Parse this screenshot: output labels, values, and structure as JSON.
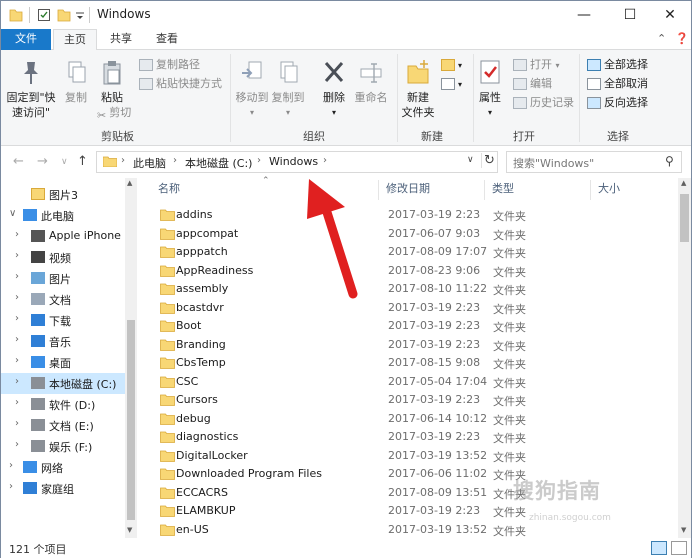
{
  "window": {
    "title": "Windows"
  },
  "controls": {
    "minimize": "—",
    "maximize": "☐",
    "close": "✕"
  },
  "tabs": {
    "file": "文件",
    "home": "主页",
    "share": "共享",
    "view": "查看"
  },
  "ribbon": {
    "clipboard": {
      "label": "剪贴板",
      "pin": "固定到\"快速访问\"",
      "copy": "复制",
      "paste": "粘贴",
      "copy_path": "复制路径",
      "paste_shortcut": "粘贴快捷方式",
      "cut": "剪切"
    },
    "organize": {
      "label": "组织",
      "move_to": "移动到",
      "copy_to": "复制到",
      "delete": "删除",
      "rename": "重命名"
    },
    "new": {
      "label": "新建",
      "new_folder": "新建\n文件夹"
    },
    "open": {
      "label": "打开",
      "properties": "属性",
      "open": "打开",
      "edit": "编辑",
      "history": "历史记录"
    },
    "select": {
      "label": "选择",
      "select_all": "全部选择",
      "select_none": "全部取消",
      "invert": "反向选择"
    }
  },
  "address": {
    "crumbs": [
      "此电脑",
      "本地磁盘 (C:)",
      "Windows"
    ],
    "search_placeholder": "搜索\"Windows\""
  },
  "nav": [
    {
      "label": "图片3",
      "icon": "folder-icon",
      "indent": 0,
      "chevron": ""
    },
    {
      "label": "此电脑",
      "icon": "computer-icon",
      "indent": 0,
      "chevron": "expanded"
    },
    {
      "label": "Apple iPhone",
      "icon": "phone-icon",
      "indent": 1,
      "chevron": "collapsed"
    },
    {
      "label": "视频",
      "icon": "video-icon",
      "indent": 1,
      "chevron": "collapsed"
    },
    {
      "label": "图片",
      "icon": "pictures-icon",
      "indent": 1,
      "chevron": "collapsed"
    },
    {
      "label": "文档",
      "icon": "documents-icon",
      "indent": 1,
      "chevron": "collapsed"
    },
    {
      "label": "下载",
      "icon": "download-icon",
      "indent": 1,
      "chevron": "collapsed"
    },
    {
      "label": "音乐",
      "icon": "music-icon",
      "indent": 1,
      "chevron": "collapsed"
    },
    {
      "label": "桌面",
      "icon": "desktop-icon",
      "indent": 1,
      "chevron": "collapsed"
    },
    {
      "label": "本地磁盘 (C:)",
      "icon": "drive-icon",
      "indent": 1,
      "chevron": "collapsed",
      "selected": true
    },
    {
      "label": "软件 (D:)",
      "icon": "drive-icon",
      "indent": 1,
      "chevron": "collapsed"
    },
    {
      "label": "文档 (E:)",
      "icon": "drive-icon",
      "indent": 1,
      "chevron": "collapsed"
    },
    {
      "label": "娱乐 (F:)",
      "icon": "drive-icon",
      "indent": 1,
      "chevron": "collapsed"
    },
    {
      "label": "网络",
      "icon": "network-icon",
      "indent": 0,
      "chevron": "collapsed"
    },
    {
      "label": "家庭组",
      "icon": "homegroup-icon",
      "indent": 0,
      "chevron": "collapsed"
    }
  ],
  "columns": {
    "name": "名称",
    "date": "修改日期",
    "type": "类型",
    "size": "大小"
  },
  "files": [
    {
      "name": "addins",
      "date": "2017-03-19 2:23",
      "type": "文件夹"
    },
    {
      "name": "appcompat",
      "date": "2017-06-07 9:03",
      "type": "文件夹"
    },
    {
      "name": "apppatch",
      "date": "2017-08-09 17:07",
      "type": "文件夹"
    },
    {
      "name": "AppReadiness",
      "date": "2017-08-23 9:06",
      "type": "文件夹"
    },
    {
      "name": "assembly",
      "date": "2017-08-10 11:22",
      "type": "文件夹"
    },
    {
      "name": "bcastdvr",
      "date": "2017-03-19 2:23",
      "type": "文件夹"
    },
    {
      "name": "Boot",
      "date": "2017-03-19 2:23",
      "type": "文件夹"
    },
    {
      "name": "Branding",
      "date": "2017-03-19 2:23",
      "type": "文件夹"
    },
    {
      "name": "CbsTemp",
      "date": "2017-08-15 9:08",
      "type": "文件夹"
    },
    {
      "name": "CSC",
      "date": "2017-05-04 17:04",
      "type": "文件夹"
    },
    {
      "name": "Cursors",
      "date": "2017-03-19 2:23",
      "type": "文件夹"
    },
    {
      "name": "debug",
      "date": "2017-06-14 10:12",
      "type": "文件夹"
    },
    {
      "name": "diagnostics",
      "date": "2017-03-19 2:23",
      "type": "文件夹"
    },
    {
      "name": "DigitalLocker",
      "date": "2017-03-19 13:52",
      "type": "文件夹"
    },
    {
      "name": "Downloaded Program Files",
      "date": "2017-06-06 11:02",
      "type": "文件夹"
    },
    {
      "name": "ECCACRS",
      "date": "2017-08-09 13:51",
      "type": "文件夹"
    },
    {
      "name": "ELAMBKUP",
      "date": "2017-03-19 2:23",
      "type": "文件夹"
    },
    {
      "name": "en-US",
      "date": "2017-03-19 13:52",
      "type": "文件夹"
    }
  ],
  "status": {
    "count": "121 个项目"
  },
  "watermark": {
    "text": "搜狗指南",
    "sub": "zhinan.sogou.com"
  },
  "colors": {
    "accent": "#1979ca",
    "folder": "#f8d775",
    "selection": "#cce8ff",
    "arrow": "#e02020"
  }
}
